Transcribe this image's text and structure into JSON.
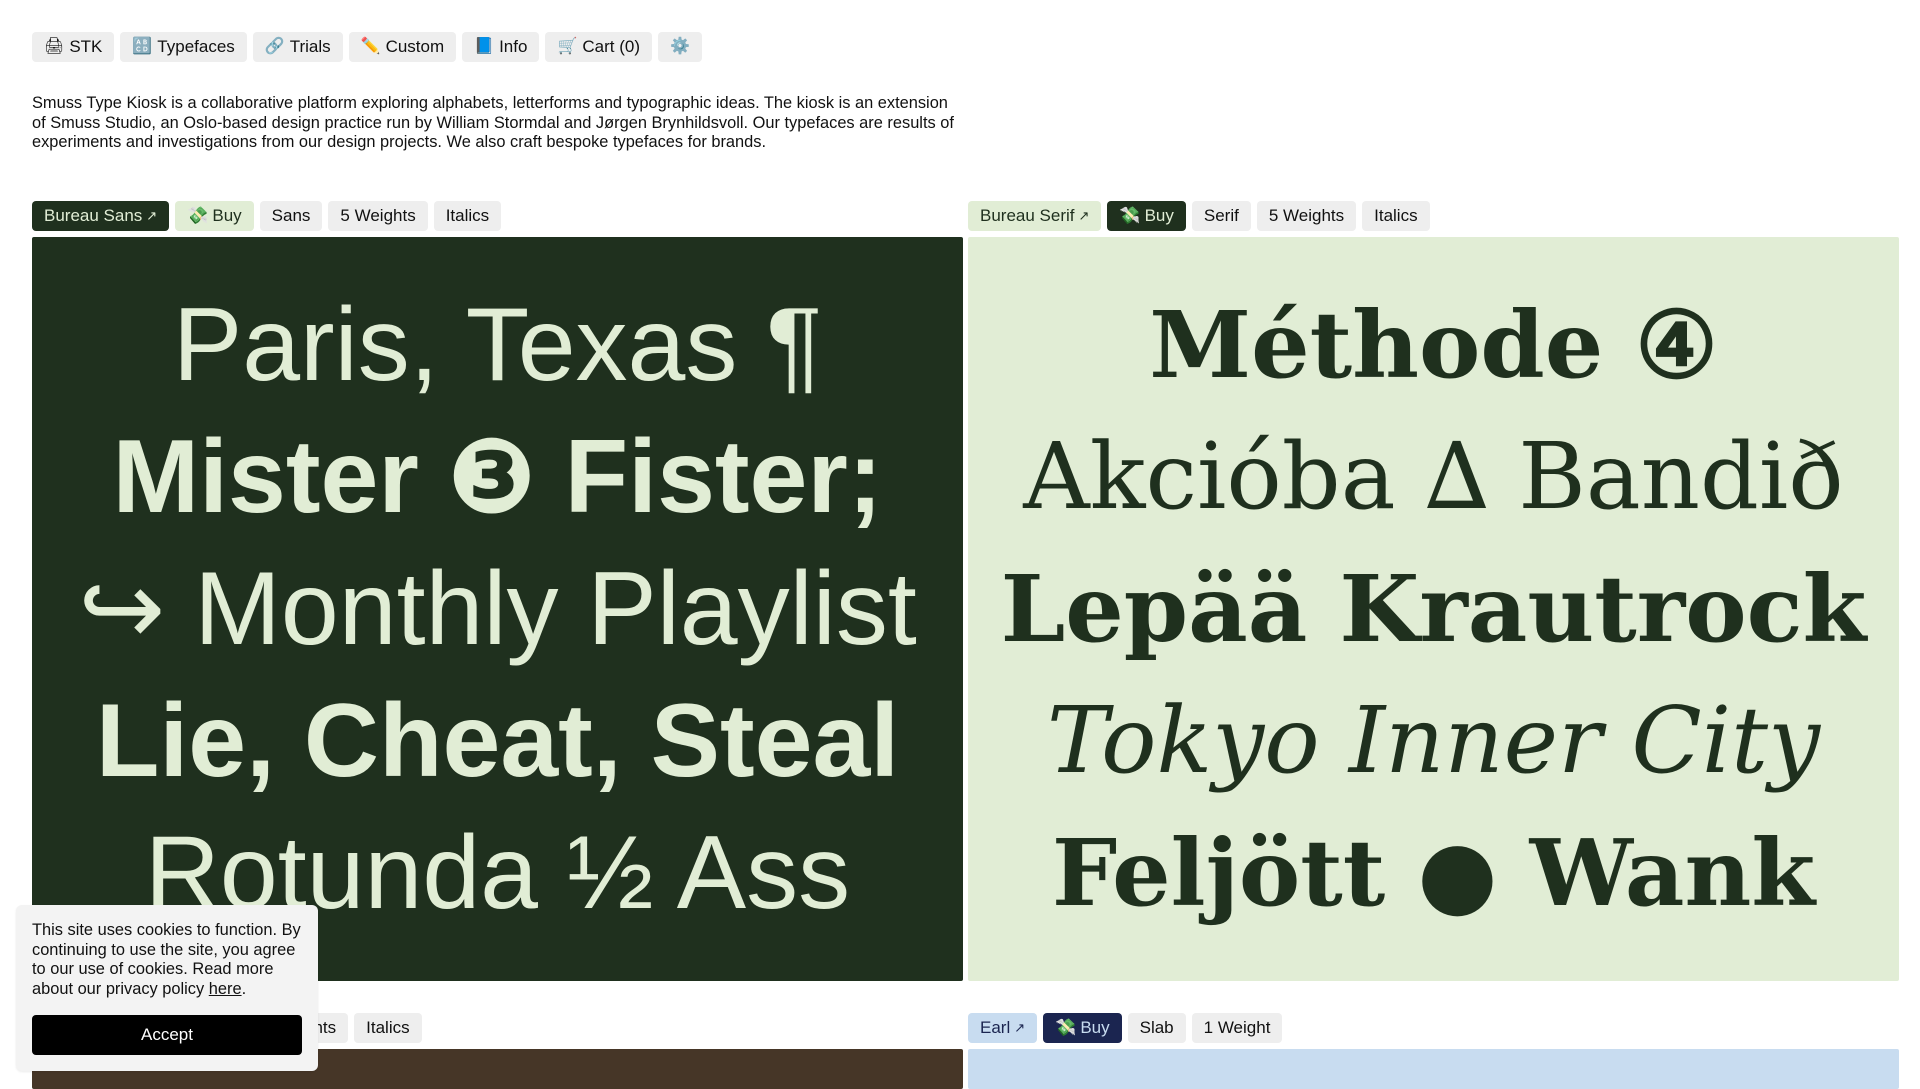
{
  "nav": [
    {
      "icon": "🖨",
      "label": "STK",
      "name": "nav-stk-button"
    },
    {
      "icon": "🔠",
      "label": "Typefaces",
      "name": "nav-typefaces-button"
    },
    {
      "icon": "🔗",
      "label": "Trials",
      "name": "nav-trials-button"
    },
    {
      "icon": "✏️",
      "label": "Custom",
      "name": "nav-custom-button"
    },
    {
      "icon": "📘",
      "label": "Info",
      "name": "nav-info-button"
    },
    {
      "icon": "🛒",
      "label": "Cart (0)",
      "name": "nav-cart-button"
    },
    {
      "icon": "⚙️",
      "label": "",
      "name": "nav-settings-button"
    }
  ],
  "intro": "Smuss Type Kiosk is a collaborative platform exploring alphabets, letterforms and typographic ideas. The kiosk is an extension of Smuss Studio, an Oslo-based design practice run by William Stormdal and Jørgen Brynhildsvoll. Our typefaces are results of experiments and investigations from our design projects. We also craft bespoke typefaces for brands.",
  "fonts": {
    "bureau_sans": {
      "name": "Bureau Sans",
      "arrow": "↗",
      "buy_icon": "💸",
      "buy_label": "Buy",
      "tags": [
        "Sans",
        "5 Weights",
        "Italics"
      ],
      "colors": {
        "bg": "#1f301e",
        "fg": "#e1edd5",
        "name_bg": "#1f301e",
        "name_fg": "#e1edd5",
        "buy_bg": "#e1edd5",
        "buy_fg": "#1f301e"
      },
      "specimen": [
        {
          "text": "Paris, Texas ¶",
          "weight": "500",
          "style": "normal"
        },
        {
          "text": "Mister ❸ Fister;",
          "weight": "700",
          "style": "normal"
        },
        {
          "text": "↪ Monthly Playlist",
          "weight": "400",
          "style": "normal"
        },
        {
          "text": "Lie, Cheat, Steal",
          "weight": "700",
          "style": "normal"
        },
        {
          "text": "Rotunda ½ Ass",
          "weight": "400",
          "style": "normal"
        }
      ]
    },
    "bureau_serif": {
      "name": "Bureau Serif",
      "arrow": "↗",
      "buy_icon": "💸",
      "buy_label": "Buy",
      "tags": [
        "Serif",
        "5 Weights",
        "Italics"
      ],
      "colors": {
        "bg": "#e1edd5",
        "fg": "#1f301e",
        "name_bg": "#e1edd5",
        "name_fg": "#1f301e",
        "buy_bg": "#1f301e",
        "buy_fg": "#e1edd5"
      },
      "specimen": [
        {
          "text": "Méthode ④",
          "weight": "700",
          "style": "normal"
        },
        {
          "text": "Akcióba ∆ Bandið",
          "weight": "400",
          "style": "normal"
        },
        {
          "text": "Lepää Krautrock",
          "weight": "700",
          "style": "normal"
        },
        {
          "text": "Tokyo Inner City",
          "weight": "400",
          "style": "italic"
        },
        {
          "text": "Feljött ● Wank",
          "weight": "700",
          "style": "normal"
        }
      ]
    },
    "third": {
      "tags_visible": [
        "ghts",
        "Italics"
      ],
      "colors": {
        "bg": "#463627"
      }
    },
    "earl": {
      "name": "Earl",
      "arrow": "↗",
      "buy_icon": "💸",
      "buy_label": "Buy",
      "tags": [
        "Slab",
        "1 Weight"
      ],
      "colors": {
        "bg": "#c8dcf0",
        "fg": "#1b2550",
        "name_bg": "#c8dcf0",
        "name_fg": "#1b2550",
        "buy_bg": "#1b2550",
        "buy_fg": "#c8dcf0"
      }
    }
  },
  "cookie": {
    "text": "This site uses cookies to function. By continuing to use the site, you agree to our use of cookies. Read more about our privacy policy ",
    "link": "here",
    "period": ".",
    "accept": "Accept"
  }
}
